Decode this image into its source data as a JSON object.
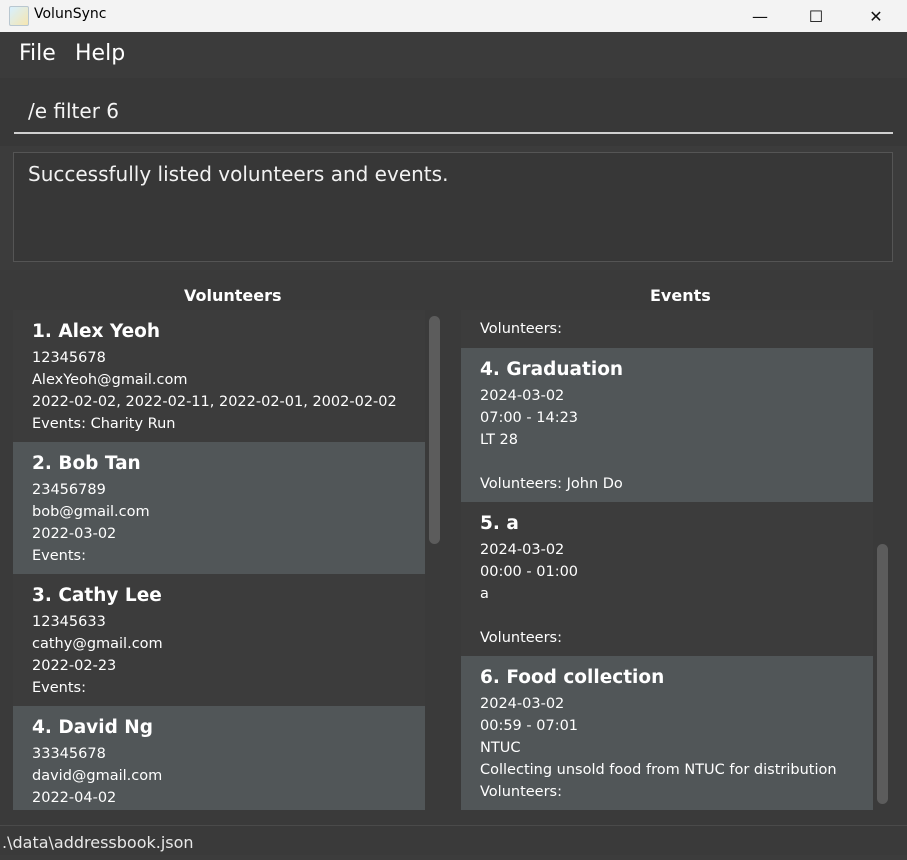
{
  "window": {
    "title": "VolunSync",
    "minimize": "—",
    "maximize": "☐",
    "close": "✕"
  },
  "menu": {
    "file": "File",
    "help": "Help"
  },
  "command": {
    "value": "/e filter 6"
  },
  "result": {
    "text": "Successfully listed volunteers and events."
  },
  "volunteers": {
    "header": "Volunteers",
    "items": [
      {
        "title": "1. Alex Yeoh",
        "phone": "12345678",
        "email": "AlexYeoh@gmail.com",
        "dates": "2022-02-02, 2022-02-11, 2022-02-01, 2002-02-02",
        "events": "Events: Charity Run"
      },
      {
        "title": "2. Bob Tan",
        "phone": "23456789",
        "email": "bob@gmail.com",
        "dates": "2022-03-02",
        "events": "Events:"
      },
      {
        "title": "3. Cathy Lee",
        "phone": "12345633",
        "email": "cathy@gmail.com",
        "dates": "2022-02-23",
        "events": "Events:"
      },
      {
        "title": "4. David Ng",
        "phone": "33345678",
        "email": "david@gmail.com",
        "dates": "2022-04-02"
      }
    ]
  },
  "events": {
    "header": "Events",
    "partial": "Volunteers:",
    "items": [
      {
        "title": "4. Graduation",
        "date": "2024-03-02",
        "time": "07:00 - 14:23",
        "location": "LT 28",
        "description": "",
        "volunteers": "Volunteers: John Do"
      },
      {
        "title": "5. a",
        "date": "2024-03-02",
        "time": "00:00 - 01:00",
        "location": "a",
        "description": "",
        "volunteers": "Volunteers:"
      },
      {
        "title": "6. Food collection",
        "date": "2024-03-02",
        "time": "00:59 - 07:01",
        "location": "NTUC",
        "description": "Collecting unsold food from NTUC for distribution",
        "volunteers": "Volunteers:"
      }
    ]
  },
  "status": {
    "path": ".\\data\\addressbook.json"
  }
}
